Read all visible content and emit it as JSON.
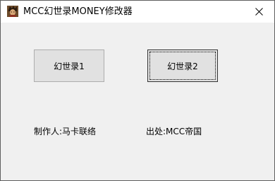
{
  "window": {
    "title": "MCC幻世录MONEY修改器",
    "icon": "character-portrait-icon"
  },
  "buttons": {
    "button1_label": "幻世录1",
    "button2_label": "幻世录2"
  },
  "labels": {
    "author": "制作人:马卡联络",
    "source": "出处:MCC帝国"
  },
  "colors": {
    "window_bg": "#f0f0f0",
    "button_bg": "#e1e1e1"
  }
}
